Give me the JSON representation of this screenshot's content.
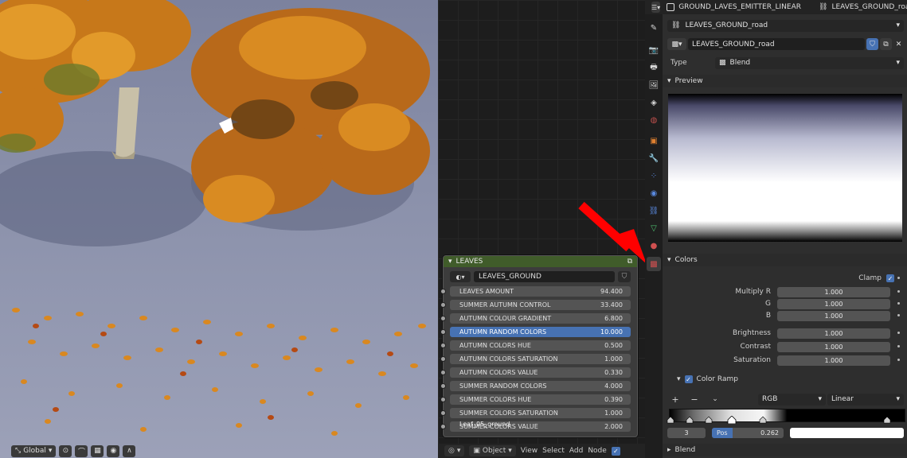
{
  "viewport": {
    "toolbar": {
      "orientation_label": "Global"
    }
  },
  "node_editor": {
    "node": {
      "title": "LEAVES",
      "group_name": "LEAVES_GROUND",
      "inputs": [
        {
          "label": "LEAVES AMOUNT",
          "value": "94.400"
        },
        {
          "label": "SUMMER AUTUMN CONTROL",
          "value": "33.400"
        },
        {
          "label": "AUTUMN COLOUR GRADIENT",
          "value": "6.800"
        },
        {
          "label": "AUTUMN RANDOM COLORS",
          "value": "10.000",
          "active": true
        },
        {
          "label": "AUTUMN COLORS HUE",
          "value": "0.500"
        },
        {
          "label": "AUTUMN COLORS SATURATION",
          "value": "1.000"
        },
        {
          "label": "AUTUMN COLORS VALUE",
          "value": "0.330"
        },
        {
          "label": "SUMMER RANDOM COLORS",
          "value": "4.000"
        },
        {
          "label": "SUMMER COLORS HUE",
          "value": "0.390"
        },
        {
          "label": "SUMMER COLORS  SATURATION",
          "value": "1.000"
        },
        {
          "label": "SUMMER COLORS VALUE",
          "value": "2.000"
        }
      ],
      "overlay_label": "Leaf_05_ground"
    },
    "toolbar": {
      "object_mode": "Object",
      "menus": [
        "View",
        "Select",
        "Add",
        "Node"
      ]
    }
  },
  "properties": {
    "breadcrumb": {
      "object": "GROUND_LAVES_EMITTER_LINEAR",
      "texture": "LEAVES_GROUND_road"
    },
    "texture_slot": "LEAVES_GROUND_road",
    "texture_name": "LEAVES_GROUND_road",
    "type_label": "Type",
    "type_value": "Blend",
    "preview_label": "Preview",
    "colors_label": "Colors",
    "clamp_label": "Clamp",
    "multiply": [
      {
        "label": "Multiply R",
        "value": "1.000"
      },
      {
        "label": "G",
        "value": "1.000"
      },
      {
        "label": "B",
        "value": "1.000"
      }
    ],
    "adjust": [
      {
        "label": "Brightness",
        "value": "1.000"
      },
      {
        "label": "Contrast",
        "value": "1.000"
      },
      {
        "label": "Saturation",
        "value": "1.000"
      }
    ],
    "color_ramp": {
      "label": "Color Ramp",
      "add": "+",
      "remove": "−",
      "color_mode": "RGB",
      "interpolation": "Linear",
      "stop_index": "3",
      "pos_label": "Pos",
      "pos_value": "0.262"
    },
    "blend_label": "Blend"
  },
  "colors": {
    "accent": "#4772b3",
    "node_header": "#405c2a",
    "arrow": "#ff0000"
  }
}
